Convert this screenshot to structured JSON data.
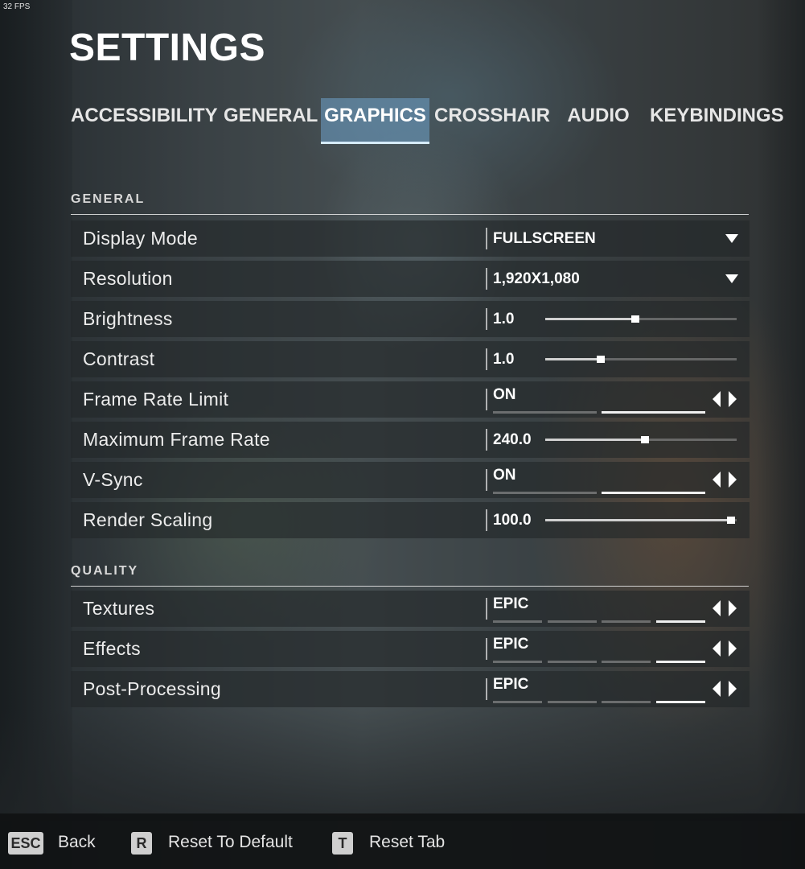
{
  "fps": "32 FPS",
  "title": "SETTINGS",
  "tabs": [
    {
      "label": "ACCESSIBILITY",
      "active": false
    },
    {
      "label": "GENERAL",
      "active": false
    },
    {
      "label": "GRAPHICS",
      "active": true
    },
    {
      "label": "CROSSHAIR",
      "active": false
    },
    {
      "label": "AUDIO",
      "active": false
    },
    {
      "label": "KEYBINDINGS",
      "active": false
    }
  ],
  "sections": {
    "general": {
      "label": "GENERAL",
      "rows": [
        {
          "label": "Display Mode",
          "type": "dropdown",
          "value": "FULLSCREEN"
        },
        {
          "label": "Resolution",
          "type": "dropdown",
          "value": "1,920X1,080"
        },
        {
          "label": "Brightness",
          "type": "slider",
          "value": "1.0",
          "fraction": 0.47
        },
        {
          "label": "Contrast",
          "type": "slider",
          "value": "1.0",
          "fraction": 0.29
        },
        {
          "label": "Frame Rate Limit",
          "type": "toggle",
          "value": "ON",
          "level": 2,
          "levels": 2
        },
        {
          "label": "Maximum Frame Rate",
          "type": "slider",
          "value": "240.0",
          "fraction": 0.52
        },
        {
          "label": "V-Sync",
          "type": "toggle",
          "value": "ON",
          "level": 2,
          "levels": 2
        },
        {
          "label": "Render Scaling",
          "type": "slider",
          "value": "100.0",
          "fraction": 0.97
        }
      ]
    },
    "quality": {
      "label": "QUALITY",
      "rows": [
        {
          "label": "Textures",
          "type": "toggle",
          "value": "EPIC",
          "level": 4,
          "levels": 4
        },
        {
          "label": "Effects",
          "type": "toggle",
          "value": "EPIC",
          "level": 4,
          "levels": 4
        },
        {
          "label": "Post-Processing",
          "type": "toggle",
          "value": "EPIC",
          "level": 4,
          "levels": 4
        }
      ]
    }
  },
  "footer": {
    "back": {
      "key": "ESC",
      "label": "Back"
    },
    "reset_default": {
      "key": "R",
      "label": "Reset To Default"
    },
    "reset_tab": {
      "key": "T",
      "label": "Reset Tab"
    }
  },
  "colors": {
    "active_tab": "#6ea0c8",
    "row_bg": "#222628",
    "footer_bg": "#101213"
  }
}
